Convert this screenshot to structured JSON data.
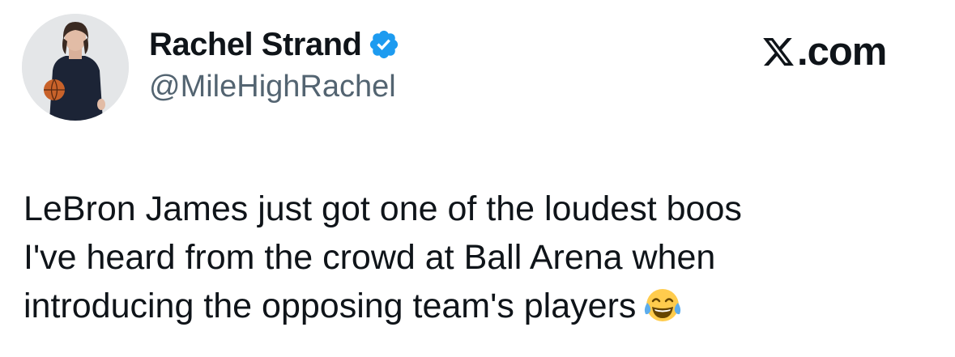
{
  "author": {
    "display_name": "Rachel Strand",
    "handle": "@MileHighRachel",
    "verified": true,
    "avatar_icon": "profile-photo-woman-with-basketball"
  },
  "brand": {
    "logo_icon": "x-logo-icon",
    "text": ".com"
  },
  "tweet": {
    "lines": [
      "LeBron James just got one of the loudest boos",
      "I've heard from the crowd at Ball Arena when",
      "introducing the opposing team's players"
    ],
    "emoji": "face-with-tears-of-joy"
  },
  "colors": {
    "text": "#0f1419",
    "secondary": "#536471",
    "verified": "#1d9bf0"
  }
}
